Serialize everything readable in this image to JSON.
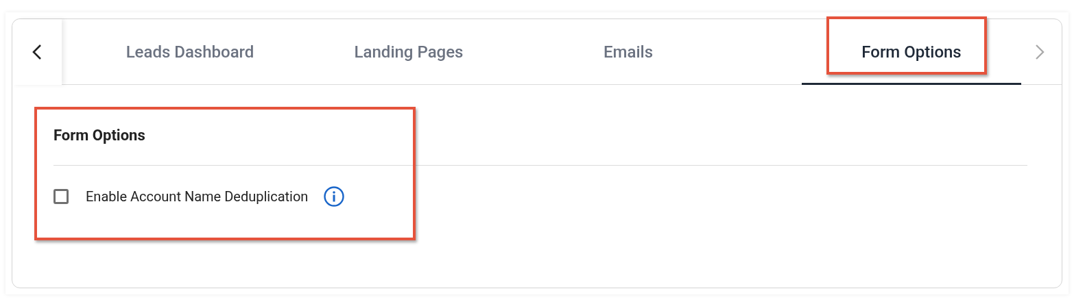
{
  "tabs": [
    {
      "label": "Leads Dashboard",
      "selected": false,
      "highlighted": false
    },
    {
      "label": "Landing Pages",
      "selected": false,
      "highlighted": false
    },
    {
      "label": "Emails",
      "selected": false,
      "highlighted": false
    },
    {
      "label": "Form Options",
      "selected": true,
      "highlighted": true
    }
  ],
  "section": {
    "title": "Form Options",
    "highlighted": true,
    "options": [
      {
        "label": "Enable Account Name Deduplication",
        "checked": false
      }
    ]
  }
}
